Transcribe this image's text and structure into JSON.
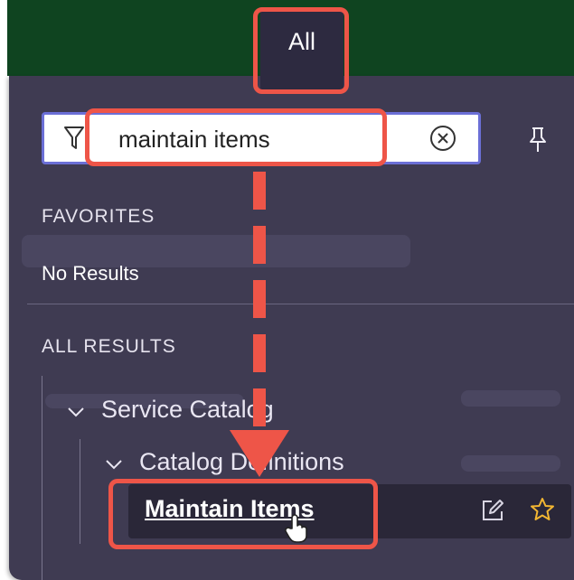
{
  "top_tab": {
    "label": "All"
  },
  "search": {
    "value": "maintain items"
  },
  "favorites": {
    "heading": "FAVORITES",
    "empty_text": "No Results"
  },
  "all_results": {
    "heading": "ALL RESULTS",
    "tree": {
      "level1": {
        "label": "Service Catalog",
        "expanded": true
      },
      "level2": {
        "label": "Catalog Definitions",
        "expanded": true
      },
      "leaf": {
        "label": "Maintain Items"
      }
    }
  },
  "icons": {
    "filter": "filter-icon",
    "clear": "clear-circle-x-icon",
    "pin": "pin-icon",
    "edit": "edit-pencil-icon",
    "favorite": "star-outline-icon",
    "cursor": "hand-pointer-icon"
  },
  "colors": {
    "topbar": "#0f4420",
    "panel": "#3f3b52",
    "search_border": "#6b6fd6",
    "highlight": "#ee5548",
    "star": "#f2b632"
  }
}
